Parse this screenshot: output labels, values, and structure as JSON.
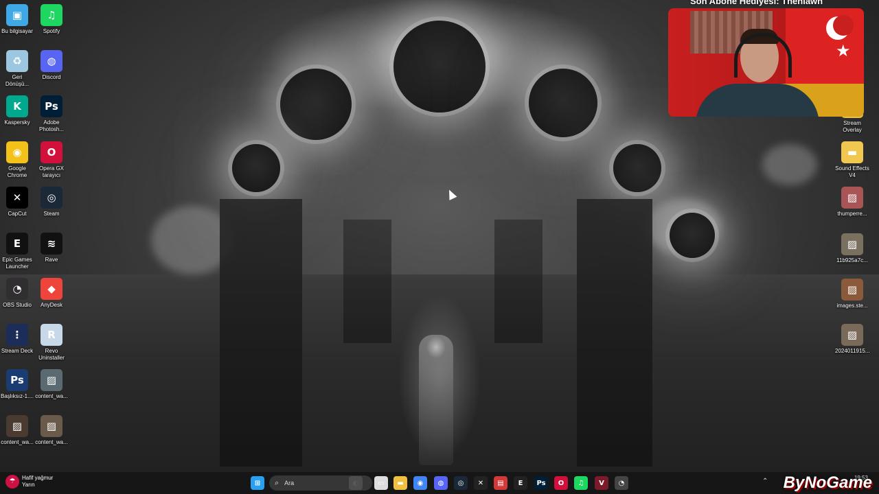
{
  "desktop": {
    "left_icons": [
      {
        "label": "Bu bilgisayar",
        "icon": "computer-icon",
        "color": "#3fa9e8"
      },
      {
        "label": "Spotify",
        "icon": "spotify-icon",
        "color": "#1ed760"
      },
      {
        "label": "Geri Dönüşü...",
        "icon": "recycle-bin-icon",
        "color": "#9cc7e0"
      },
      {
        "label": "Discord",
        "icon": "discord-icon",
        "color": "#5865f2"
      },
      {
        "label": "Kaspersky",
        "icon": "kaspersky-icon",
        "color": "#00a88e"
      },
      {
        "label": "Adobe Photosh...",
        "icon": "photoshop-icon",
        "color": "#001e36"
      },
      {
        "label": "Google Chrome",
        "icon": "chrome-icon",
        "color": "#f2c21b"
      },
      {
        "label": "Opera GX tarayıcı",
        "icon": "opera-gx-icon",
        "color": "#d1103b"
      },
      {
        "label": "CapCut",
        "icon": "capcut-icon",
        "color": "#000000"
      },
      {
        "label": "Steam",
        "icon": "steam-icon",
        "color": "#1b2838"
      },
      {
        "label": "Epic Games Launcher",
        "icon": "epic-games-icon",
        "color": "#111111"
      },
      {
        "label": "Rave",
        "icon": "rave-icon",
        "color": "#111111"
      },
      {
        "label": "OBS Studio",
        "icon": "obs-icon",
        "color": "#302e31"
      },
      {
        "label": "AnyDesk",
        "icon": "anydesk-icon",
        "color": "#ef443b"
      },
      {
        "label": "Stream Deck",
        "icon": "stream-deck-icon",
        "color": "#1c2d5a"
      },
      {
        "label": "Revo Uninstaller",
        "icon": "revo-uninstaller-icon",
        "color": "#c7d8e8"
      },
      {
        "label": "Başlıksız-1....",
        "icon": "psd-file-icon",
        "color": "#1a3c72"
      },
      {
        "label": "content_wa...",
        "icon": "image-file-icon",
        "color": "#5a6a70"
      },
      {
        "label": "content_wa...",
        "icon": "image-file-icon",
        "color": "#4a3a30"
      },
      {
        "label": "content_wa...",
        "icon": "image-file-icon",
        "color": "#6a5a4a"
      }
    ],
    "right_icons": [
      {
        "label": "Stream Overlay",
        "icon": "folder-icon",
        "color": "#e8c04a"
      },
      {
        "label": "Sound Effects V4",
        "icon": "folder-icon",
        "color": "#f0c850"
      },
      {
        "label": "thumperre...",
        "icon": "image-file-icon",
        "color": "#aa5555"
      },
      {
        "label": "11b925a7c...",
        "icon": "image-file-icon",
        "color": "#7a7060"
      },
      {
        "label": "images.ste...",
        "icon": "image-file-icon",
        "color": "#8a5a3a"
      },
      {
        "label": "2024011915...",
        "icon": "image-file-icon",
        "color": "#7a6a5a"
      }
    ]
  },
  "webcam": {
    "title": "Son Abone Hediyesi: Theniawn"
  },
  "taskbar": {
    "weather_title": "Hafif yağmur",
    "weather_sub": "Yarın",
    "search_placeholder": "Ara",
    "time_text": "19:53",
    "apps": [
      {
        "icon": "windows-start-icon",
        "glyph": "⊞",
        "color": "#2aa0f0"
      },
      {
        "icon": "copilot-icon",
        "glyph": "◐",
        "color": "#b0b0b0"
      },
      {
        "icon": "task-view-icon",
        "glyph": "▭",
        "color": "#dddddd"
      },
      {
        "icon": "file-explorer-icon",
        "glyph": "▬",
        "color": "#f0c040"
      },
      {
        "icon": "chrome-icon",
        "glyph": "◉",
        "color": "#4285f4"
      },
      {
        "icon": "discord-icon",
        "glyph": "◍",
        "color": "#5865f2"
      },
      {
        "icon": "steam-icon",
        "glyph": "◎",
        "color": "#1b2838"
      },
      {
        "icon": "capcut-icon",
        "glyph": "✕",
        "color": "#222222"
      },
      {
        "icon": "news-icon",
        "glyph": "▤",
        "color": "#d23a3a"
      },
      {
        "icon": "epic-games-icon",
        "glyph": "E",
        "color": "#222222"
      },
      {
        "icon": "photoshop-icon",
        "glyph": "Ps",
        "color": "#001e36"
      },
      {
        "icon": "opera-gx-icon",
        "glyph": "O",
        "color": "#d1103b"
      },
      {
        "icon": "spotify-icon",
        "glyph": "♫",
        "color": "#1ed760"
      },
      {
        "icon": "vegas-icon",
        "glyph": "V",
        "color": "#7a1a2a"
      },
      {
        "icon": "obs-icon",
        "glyph": "◔",
        "color": "#444444"
      }
    ]
  },
  "watermark": "ByNoGame"
}
